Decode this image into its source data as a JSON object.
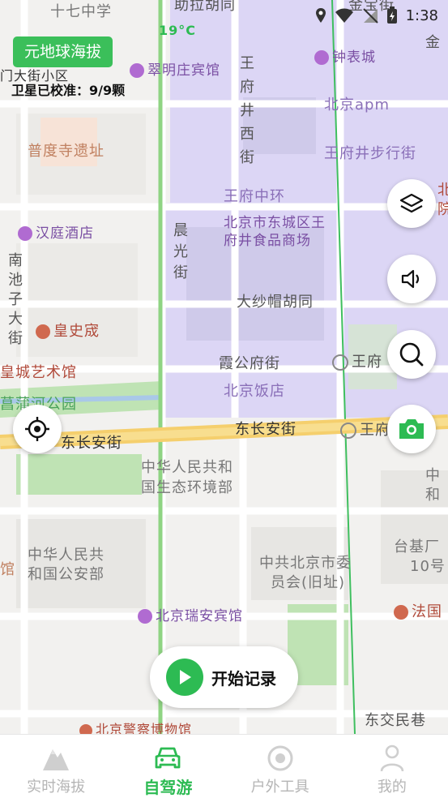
{
  "status_bar": {
    "time": "1:38"
  },
  "altitude_tag": "元地球海拔",
  "weather": {
    "temp": "19°C"
  },
  "satellite_status": "卫星已校准：9/9颗",
  "map_labels": {
    "shiqi_middle": "十七中学",
    "hutong_top": "助拉胡同",
    "jinbao": "金宝街",
    "residential": "门大街小区",
    "cuiming_hotel": "翠明庄宾馆",
    "wangfujing_west": [
      "王",
      "府",
      "井",
      "西",
      "街"
    ],
    "clock_museum": "钟表城",
    "beijing_apm": "北京apm",
    "pudusi": "普度寺遗址",
    "wfj_pedestrian": "王府井步行街",
    "wfj_central": "王府中环",
    "food_mall_1": "北京市东城区王",
    "food_mall_2": "府井食品商场",
    "hanting": "汉庭酒店",
    "chenguang": [
      "晨",
      "光",
      "街"
    ],
    "nanchizi": [
      "南",
      "池",
      "子",
      "大",
      "街"
    ],
    "huangshicheng": "皇史宬",
    "dashamao": "大纱帽胡同",
    "huangcheng_art": "皇城艺术馆",
    "xiagong": "霞公府街",
    "wangfu_station_1": "王府",
    "beijing_hotel": "北京饭店",
    "changpu_park": "菖蒲河公园",
    "dong_changan_left": "东长安街",
    "dong_changan_mid": "东长安街",
    "wangfu_station_2": "王府",
    "ministry_eco_1": "中华人民共和",
    "ministry_eco_2": "国生态环境部",
    "ministry_ps_1": "中华人民共",
    "ministry_ps_2": "和国公安部",
    "cpc_committee_1": "中共北京市委",
    "cpc_committee_2": "员会(旧址)",
    "taiji_1": "台基厂",
    "taiji_2": "10号",
    "rui_an": "北京瑞安宾馆",
    "fa_guo": "法国",
    "police_museum": "北京警察博物馆",
    "dongjiaomin": "东交民巷",
    "edge_bei": "北",
    "edge_yuan": "院",
    "edge_zhong": "中",
    "edge_he": "和",
    "edge_guan": "馆",
    "edge_jin": "金"
  },
  "fab_buttons": [
    "layers-icon",
    "volume-icon",
    "search-icon",
    "camera-icon",
    "locate-icon"
  ],
  "start_button": {
    "label": "开始记录"
  },
  "tabs": [
    {
      "label": "实时海拔",
      "active": false
    },
    {
      "label": "自驾游",
      "active": true
    },
    {
      "label": "户外工具",
      "active": false
    },
    {
      "label": "我的",
      "active": false
    }
  ],
  "colors": {
    "accent": "#2dbb53",
    "tag_bg": "#3bbf5a",
    "district": "#dcd6f5"
  }
}
